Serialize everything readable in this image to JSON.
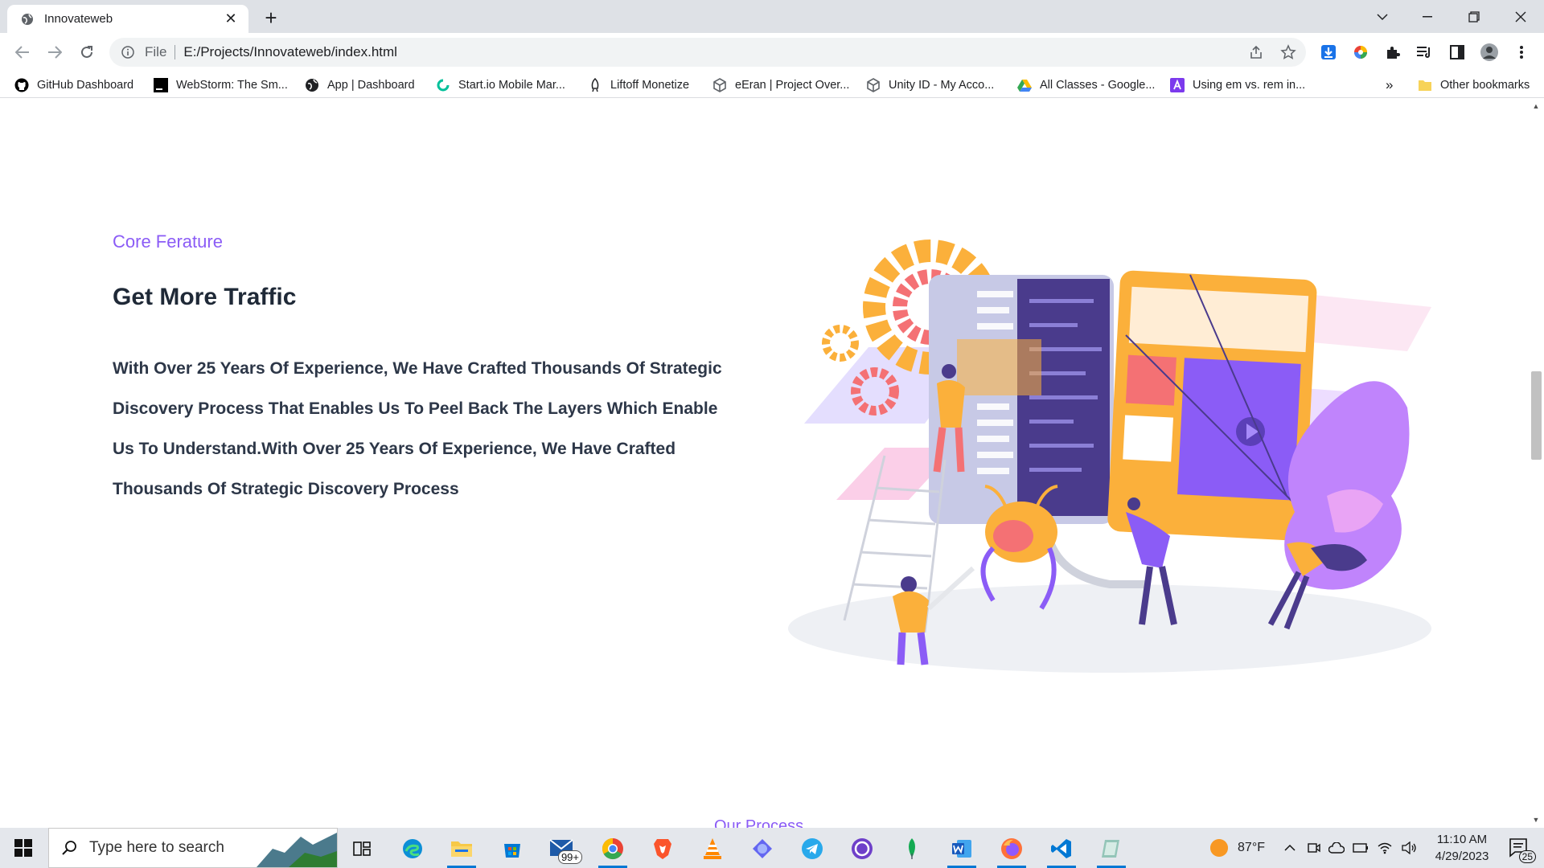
{
  "browser": {
    "tab": {
      "title": "Innovateweb",
      "close": "✕"
    },
    "new_tab": "+",
    "window_controls": {
      "minimize": "—",
      "maximize": "❐",
      "close": "✕"
    },
    "omnibox": {
      "scheme": "File",
      "url": "E:/Projects/Innovateweb/index.html"
    },
    "bookmarks": [
      {
        "label": "GitHub Dashboard",
        "icon": "github-icon"
      },
      {
        "label": "WebStorm: The Sm...",
        "icon": "webstorm-icon"
      },
      {
        "label": "App | Dashboard",
        "icon": "globe-icon"
      },
      {
        "label": "Start.io Mobile Mar...",
        "icon": "startio-icon"
      },
      {
        "label": "Liftoff Monetize",
        "icon": "rocket-icon"
      },
      {
        "label": "eEran | Project Over...",
        "icon": "unity-icon"
      },
      {
        "label": "Unity ID - My Acco...",
        "icon": "unity-icon"
      },
      {
        "label": "All Classes - Google...",
        "icon": "drive-icon"
      },
      {
        "label": "Using em vs. rem in...",
        "icon": "bookmark-a-icon"
      }
    ],
    "bookmarks_overflow": "»",
    "other_bookmarks": "Other bookmarks"
  },
  "page": {
    "eyebrow": "Core Ferature",
    "heading": "Get More Traffic",
    "paragraph": "With Over 25 Years Of Experience, We Have Crafted Thousands Of Strategic Discovery Process That Enables Us To Peel Back The Layers Which Enable Us To Understand.With Over 25 Years Of Experience, We Have Crafted Thousands Of Strategic Discovery Process",
    "next_section": "Our Process"
  },
  "taskbar": {
    "search_placeholder": "Type here to search",
    "mail_badge": "99+",
    "weather": "87°F",
    "time": "11:10 AM",
    "date": "4/29/2023",
    "notifications": "25"
  },
  "colors": {
    "accent": "#8b5cf6",
    "heading": "#1f2937",
    "orange": "#fbb03b",
    "purple": "#8b5cf6"
  }
}
